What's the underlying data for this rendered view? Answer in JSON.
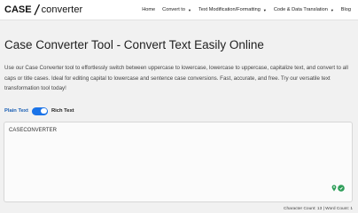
{
  "logo": {
    "left": "CASE",
    "right": "converter"
  },
  "nav": {
    "items": [
      {
        "label": "Home",
        "caret": false
      },
      {
        "label": "Convert to",
        "caret": true
      },
      {
        "label": "Text Modification/Formatting",
        "caret": true
      },
      {
        "label": "Code & Data Translation",
        "caret": true
      },
      {
        "label": "Blog",
        "caret": false
      }
    ],
    "caret_glyph": "▼"
  },
  "page": {
    "title": "Case Converter Tool - Convert Text Easily Online",
    "description": "Use our Case Converter tool to effortlessly switch between uppercase to lowercase, lowercase to uppercase, capitalize text, and convert to all caps or title cases. Ideal for editing capital to lowercase and sentence case conversions. Fast, accurate, and free. Try our versatile text transformation tool today!"
  },
  "mode_toggle": {
    "left_label": "Plain Text",
    "right_label": "Rich Text",
    "state": "on"
  },
  "editor": {
    "value": "CASECONVERTER"
  },
  "counts": {
    "text": "Character Count: 13 | Word Count: 1"
  },
  "colors": {
    "accent": "#1a73e8",
    "background": "#f1f1f1",
    "grammar_icon": "#2e9e59"
  },
  "icons": [
    "slash-logo-icon",
    "caret-down-icon",
    "grammar-check-icon",
    "location-pin-icon"
  ]
}
